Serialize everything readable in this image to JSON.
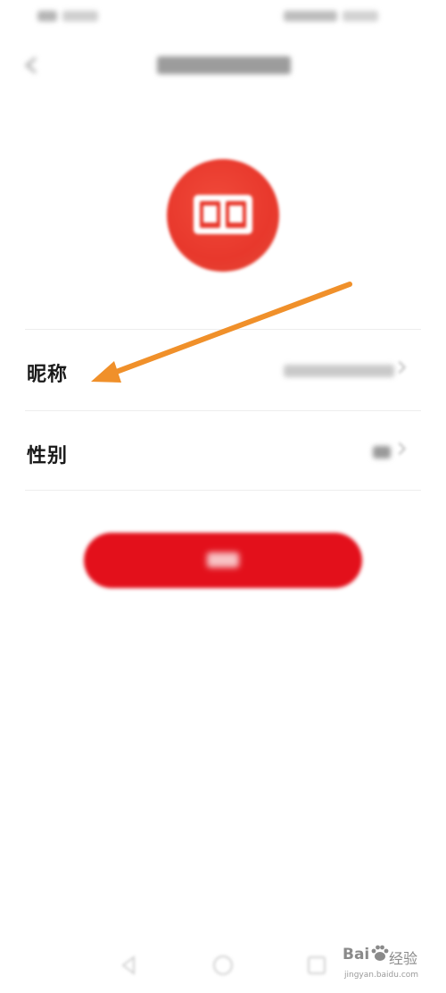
{
  "form": {
    "rows": [
      {
        "label": "昵称"
      },
      {
        "label": "性别"
      }
    ]
  },
  "watermark": {
    "brand": "Bai",
    "brand_cn": "经验",
    "url": "jingyan.baidu.com"
  },
  "colors": {
    "accent_red": "#e3101b",
    "avatar_red": "#e8382c",
    "annotation_orange": "#f0902a"
  },
  "icons": {
    "header_back": "back-arrow-icon",
    "avatar": "book-icon",
    "nav": [
      "nav-back-icon",
      "nav-home-icon",
      "nav-recents-icon"
    ]
  }
}
